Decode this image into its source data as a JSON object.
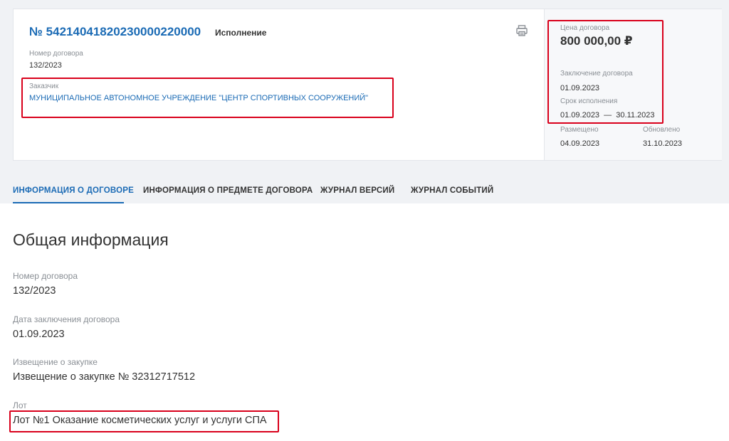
{
  "header": {
    "registry_number": "№ 54214041820230000220000",
    "status": "Исполнение",
    "contract_number_label": "Номер договора",
    "contract_number": "132/2023",
    "customer_label": "Заказчик",
    "customer_name": "МУНИЦИПАЛЬНОЕ АВТОНОМНОЕ УЧРЕЖДЕНИЕ \"ЦЕНТР СПОРТИВНЫХ СООРУЖЕНИЙ\"",
    "print_icon": "printer-icon"
  },
  "summary": {
    "price_label": "Цена договора",
    "price": "800 000,00 ₽",
    "conclusion_label": "Заключение договора",
    "conclusion_date": "01.09.2023",
    "term_label": "Срок исполнения",
    "term_value": "01.09.2023  —  30.11.2023",
    "placed_label": "Размещено",
    "placed_date": "04.09.2023",
    "updated_label": "Обновлено",
    "updated_date": "31.10.2023"
  },
  "tabs": [
    {
      "label": "ИНФОРМАЦИЯ О ДОГОВОРЕ",
      "active": true
    },
    {
      "label": "ИНФОРМАЦИЯ О ПРЕДМЕТЕ ДОГОВОРА",
      "active": false
    },
    {
      "label": "ЖУРНАЛ ВЕРСИЙ",
      "active": false
    },
    {
      "label": "ЖУРНАЛ СОБЫТИЙ",
      "active": false
    }
  ],
  "general": {
    "title": "Общая информация",
    "fields": [
      {
        "label": "Номер договора",
        "value": "132/2023"
      },
      {
        "label": "Дата заключения договора",
        "value": "01.09.2023"
      },
      {
        "label": "Извещение о закупке",
        "value": "Извещение о закупке № 32312717512"
      },
      {
        "label": "Лот",
        "value": "Лот №1 Оказание косметических услуг и услуги СПА"
      }
    ]
  },
  "colors": {
    "accent": "#1b6bb5",
    "highlight": "#d9001b",
    "background": "#f0f2f5"
  }
}
